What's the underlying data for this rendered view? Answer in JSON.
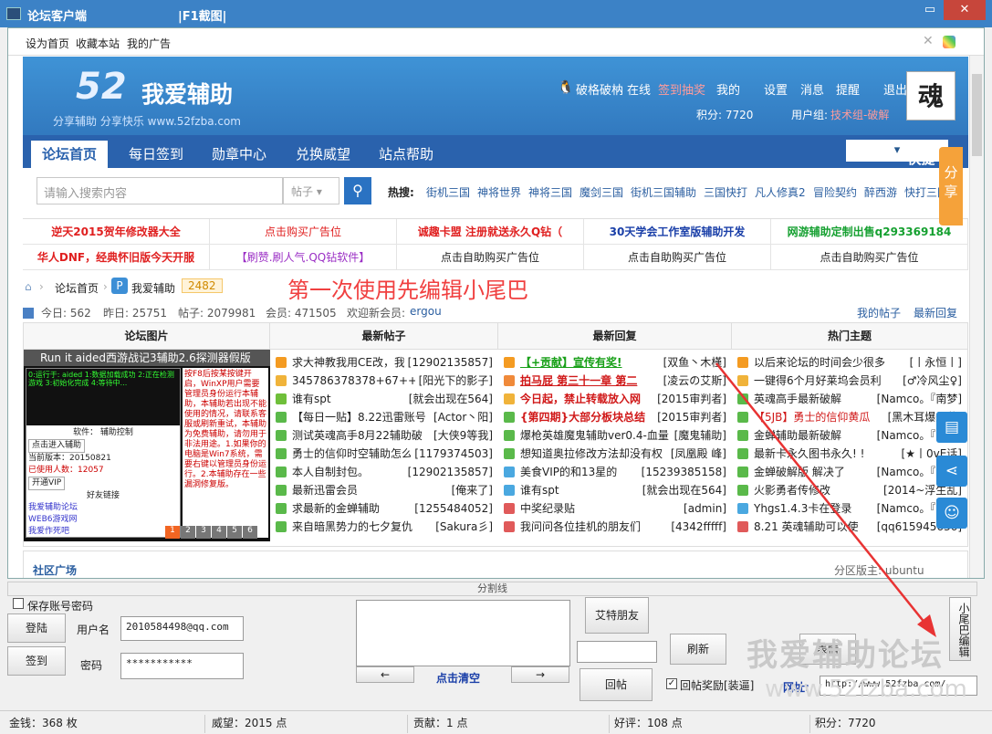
{
  "window": {
    "title": "论坛客户端",
    "subtitle": "|F1截图|",
    "minimize": "▭",
    "close": "✕"
  },
  "toplinks": [
    "设为首页",
    "收藏本站",
    "我的广告"
  ],
  "header": {
    "logo_num": "52",
    "logo_text": "我爱辅助",
    "slogan": "分享辅助 分享快乐 www.52fzba.com",
    "avatar": "魂",
    "user": "破格破枘",
    "online": "在线",
    "checkin": "签到抽奖",
    "my": "我的",
    "settings": "设置",
    "messages": "消息",
    "remind": "提醒",
    "logout": "退出",
    "points": "积分: 7720",
    "usergroup_label": "用户组:",
    "usergroup": "技术组-破解"
  },
  "nav": {
    "items": [
      "论坛首页",
      "每日签到",
      "勋章中心",
      "兑换威望",
      "站点帮助"
    ],
    "quick": "快捷导航"
  },
  "search": {
    "placeholder": "请输入搜索内容",
    "type": "帖子",
    "hot_label": "热搜:",
    "hot": [
      "街机三国",
      "神将世界",
      "神将三国",
      "魔剑三国",
      "街机三国辅助",
      "三国快打",
      "凡人修真2",
      "冒险契约",
      "醉西游",
      "快打三国"
    ]
  },
  "ads": [
    [
      "逆天2015贺年修改器大全",
      "点击购买广告位",
      "诚趣卡盟 注册就送永久Q钻（",
      "30天学会工作室版辅助开发",
      "网游辅助定制出售q293369184"
    ],
    [
      "华人DNF，经典怀旧版今天开服",
      "【刷赞.刷人气.QQ钻软件】",
      "点击自助购买广告位",
      "点击自助购买广告位",
      "点击自助购买广告位"
    ]
  ],
  "breadcrumb": {
    "home": "论坛首页",
    "forum": "我爱辅助",
    "count": "2482",
    "note": "第一次使用先编辑小尾巴"
  },
  "stats": {
    "today": "今日: 562",
    "yesterday": "昨日: 25751",
    "posts": "帖子: 2079981",
    "members": "会员: 471505",
    "welcome": "欢迎新会员:",
    "newmember": "ergou",
    "myposts": "我的帖子",
    "latest": "最新回复"
  },
  "columns": {
    "pics": "论坛图片",
    "newposts": "最新帖子",
    "newreplies": "最新回复",
    "hot": "热门主题"
  },
  "pic_caption": "Run it aided西游战记3辅助2.6探测器假版",
  "pic_window": [
    "软件：  辅助控制",
    "点击进入辅助",
    "当前版本：20150821",
    "已使用人数：12057",
    "开通VIP",
    "好友链接",
    "我爱辅助论坛",
    "WEB6游戏网",
    "我爱作死吧"
  ],
  "pic_text": "按F8后按某按键开启，WinXP用户需要管理员身份运行本辅助，本辅助若出现不能使用的情况，请联系客服或刷新重试，本辅助为免费辅助，请勿用于非法用途。1.如果你的电脑是Win7系统，需要右键以管理员身份运行。2.本辅助存在一些漏洞修复版。",
  "pager": [
    "1",
    "2",
    "3",
    "4",
    "5",
    "6"
  ],
  "newposts": [
    [
      "求大神教我用CE改，我",
      "[12902135857]"
    ],
    [
      "345786378378+67++7",
      "[阳光下的影子]"
    ],
    [
      "谁有spt",
      "[就会出现在564]"
    ],
    [
      "【每日一贴】8.22迅雷账号",
      "[Actor丶阳]"
    ],
    [
      "测试英魂高手8月22辅助破",
      "[大侠9等我]"
    ],
    [
      "勇士的信仰时空辅助怎么",
      "[1179374503]"
    ],
    [
      "本人自制封包。",
      "[12902135857]"
    ],
    [
      "最新迅雷会员",
      "[俺来了]"
    ],
    [
      "求最新的金蝉辅助",
      "[1255484052]"
    ],
    [
      "来自暗黑势力的七夕复仇",
      "[Sakura彡]"
    ]
  ],
  "newreplies": [
    [
      "【+贡献】宣传有奖!",
      "[双鱼丶木槿]"
    ],
    [
      "拍马屁 第三十一章 第二",
      "[凌云の艾斯]"
    ],
    [
      "今日起，禁止转载放入网",
      "[2015审判者]"
    ],
    [
      "{第四期}大部分板块总结",
      "[2015审判者]"
    ],
    [
      "爆枪英雄魔鬼辅助ver0.4-血量",
      "[魔鬼辅助]"
    ],
    [
      "想知道奥拉修改方法却没有权",
      "[凤凰殿 峰]"
    ],
    [
      "美食VIP的和13星的",
      "[15239385158]"
    ],
    [
      "谁有spt",
      "[就会出现在564]"
    ],
    [
      "中奖纪录贴",
      "[admin]"
    ],
    [
      "我问问各位挂机的朋友们",
      "[4342fffff]"
    ]
  ],
  "hot": [
    [
      "以后来论坛的时间会少很多",
      "[丨永恒丨]"
    ],
    [
      "一键得6个月好莱坞会员利",
      "[♂冷风尘♀]"
    ],
    [
      "英魂高手最新破解",
      "[Namco。『南梦]"
    ],
    [
      "【5JB】勇士的信仰黄瓜",
      "[黑木耳爆炒黄]"
    ],
    [
      "金蝉辅助最新破解",
      "[Namco。『南梦]"
    ],
    [
      "最新卡永久图书永久!  !",
      "[★丨0vE话]"
    ],
    [
      "金蝉破解版  解决了",
      "[Namco。『南梦]"
    ],
    [
      "火影勇者传修改",
      "[2014~浮生乱]"
    ],
    [
      "Yhgs1.4.3卡在登录",
      "[Namco。『南梦]"
    ],
    [
      "8.21 英魂辅助可以使",
      "[qq615945636]"
    ]
  ],
  "section": {
    "title": "社区广场",
    "right": "分区版主: ubuntu"
  },
  "side": {
    "share": "分享"
  },
  "panel": {
    "divider": "分割线",
    "save_pw": "保存账号密码",
    "login": "登陆",
    "signin": "签到",
    "user_label": "用户名",
    "user_value": "2010584498@qq.com",
    "pw_label": "密码",
    "pw_value": "***********",
    "at_friend": "艾特朋友",
    "refresh": "刷新",
    "clear": "点击清空",
    "prev": "←",
    "next": "→",
    "reply": "回帖",
    "reward": "回帖奖励[装逼]",
    "emoji": "表情",
    "tail": "小尾巴编辑",
    "url_label": "网址:",
    "url_value": "http://www.52fzba.com/"
  },
  "watermark": {
    "line1": "我爱辅助论坛",
    "line2": "www.52fzba.com"
  },
  "status": {
    "money": "金钱：368 枚",
    "prestige": "威望：2015 点",
    "contribution": "贡献：1 点",
    "praise": "好评：108 点",
    "points": "积分：7720"
  }
}
